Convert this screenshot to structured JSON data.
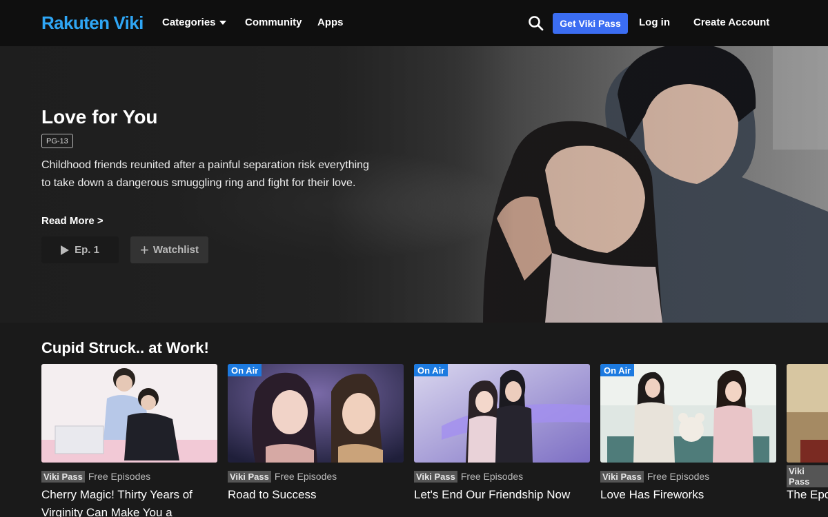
{
  "header": {
    "logo_part1": "Rakuten",
    "logo_part2": "Viki",
    "nav": {
      "categories": "Categories",
      "community": "Community",
      "apps": "Apps"
    },
    "get_pass": "Get Viki Pass",
    "login": "Log in",
    "create_account": "Create Account"
  },
  "hero": {
    "title": "Love for You",
    "rating": "PG-13",
    "description": "Childhood friends reunited after a painful separation risk everything to take down a dangerous smuggling ring and fight for their love.",
    "read_more": "Read More >",
    "episode_button": "Ep. 1",
    "watchlist_button": "Watchlist"
  },
  "row": {
    "title": "Cupid Struck.. at Work!",
    "cards": [
      {
        "title": "Cherry Magic! Thirty Years of Virginity Can Make You a Wizard?!",
        "pass": "Viki Pass",
        "free": "Free Episodes",
        "badge": ""
      },
      {
        "title": "Road to Success",
        "pass": "Viki Pass",
        "free": "Free Episodes",
        "badge": "On Air"
      },
      {
        "title": "Let's End Our Friendship Now",
        "pass": "Viki Pass",
        "free": "Free Episodes",
        "badge": "On Air"
      },
      {
        "title": "Love Has Fireworks",
        "pass": "Viki Pass",
        "free": "Free Episodes",
        "badge": "On Air"
      },
      {
        "title": "The Epo",
        "pass": "Viki Pass",
        "free": "",
        "badge": ""
      }
    ]
  },
  "colors": {
    "brand": "#2fa6f5",
    "pass_button": "#3b6df2",
    "on_air": "#1c7ae0"
  }
}
